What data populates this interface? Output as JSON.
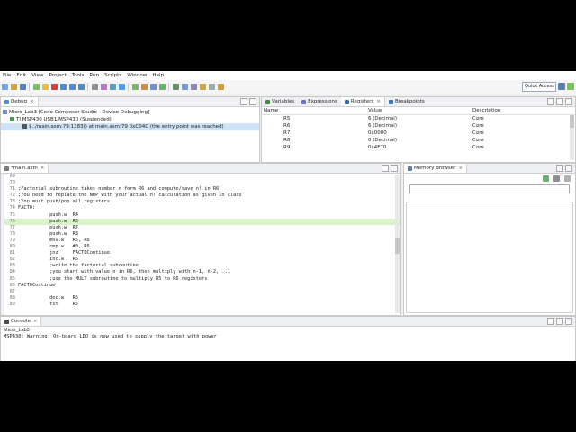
{
  "menu": [
    "File",
    "Edit",
    "View",
    "Project",
    "Tools",
    "Run",
    "Scripts",
    "Window",
    "Help"
  ],
  "quick_access": "Quick Access",
  "debug": {
    "tab": "Debug",
    "tree": [
      "Micro_Lab3 [Code Composer Studio - Device Debugging]",
      "TI MSP430 USB1/MSP430 (Suspended)",
      "$../main.asm:79:1383() at main.asm:79 0xC04C  (the entry point was reached)"
    ]
  },
  "registers": {
    "tabs": [
      "Variables",
      "Expressions",
      "Registers",
      "Breakpoints"
    ],
    "columns": [
      "Name",
      "Value",
      "Description"
    ],
    "rows": [
      {
        "name": "R5",
        "value": "6 (Decimal)",
        "desc": "Core"
      },
      {
        "name": "R6",
        "value": "6 (Decimal)",
        "desc": "Core"
      },
      {
        "name": "R7",
        "value": "0x0000",
        "desc": "Core"
      },
      {
        "name": "R8",
        "value": "0 (Decimal)",
        "desc": "Core"
      },
      {
        "name": "R9",
        "value": "0x4F70",
        "desc": "Core"
      }
    ]
  },
  "editor": {
    "tab": "*main.asm",
    "lines": [
      {
        "n": "69",
        "t": ""
      },
      {
        "n": "70",
        "t": ""
      },
      {
        "n": "71",
        "t": ";Factorial subroutine takes number n form R6 and compute/save n! in R6"
      },
      {
        "n": "72",
        "t": ";You need to replace the NOP with your actual n! calculation as given in class"
      },
      {
        "n": "73",
        "t": ";You must push/pop all registers"
      },
      {
        "n": "74",
        "t": "FACTO:"
      },
      {
        "n": "75",
        "t": "           push.w  R4"
      },
      {
        "n": "76",
        "t": "           push.w  R5"
      },
      {
        "n": "77",
        "t": "           push.w  R7"
      },
      {
        "n": "78",
        "t": "           push.w  R8"
      },
      {
        "n": "79",
        "t": "           mov.w   R5, R6"
      },
      {
        "n": "80",
        "t": "           cmp.w   #0, R6"
      },
      {
        "n": "81",
        "t": "           jnz     FACTOContinue"
      },
      {
        "n": "82",
        "t": "           inc.w   R6"
      },
      {
        "n": "83",
        "t": "           ;write the factorial subroutine"
      },
      {
        "n": "84",
        "t": "           ;you start with value n in R6, then multiply with n-1, n-2, ..1"
      },
      {
        "n": "85",
        "t": "           ;use the MULT subroutine to multiply R5 to R6 registers"
      },
      {
        "n": "86",
        "t": "FACTOContinue"
      },
      {
        "n": "87",
        "t": ""
      },
      {
        "n": "88",
        "t": "           dec.w   R5"
      },
      {
        "n": "89",
        "t": "           tst     R5"
      }
    ]
  },
  "memory": {
    "tab": "Memory Browser"
  },
  "console": {
    "tab": "Console",
    "title": "Micro_Lab3",
    "message": "MSP430: Warning: On-board LDO is now used to supply the target with power"
  }
}
